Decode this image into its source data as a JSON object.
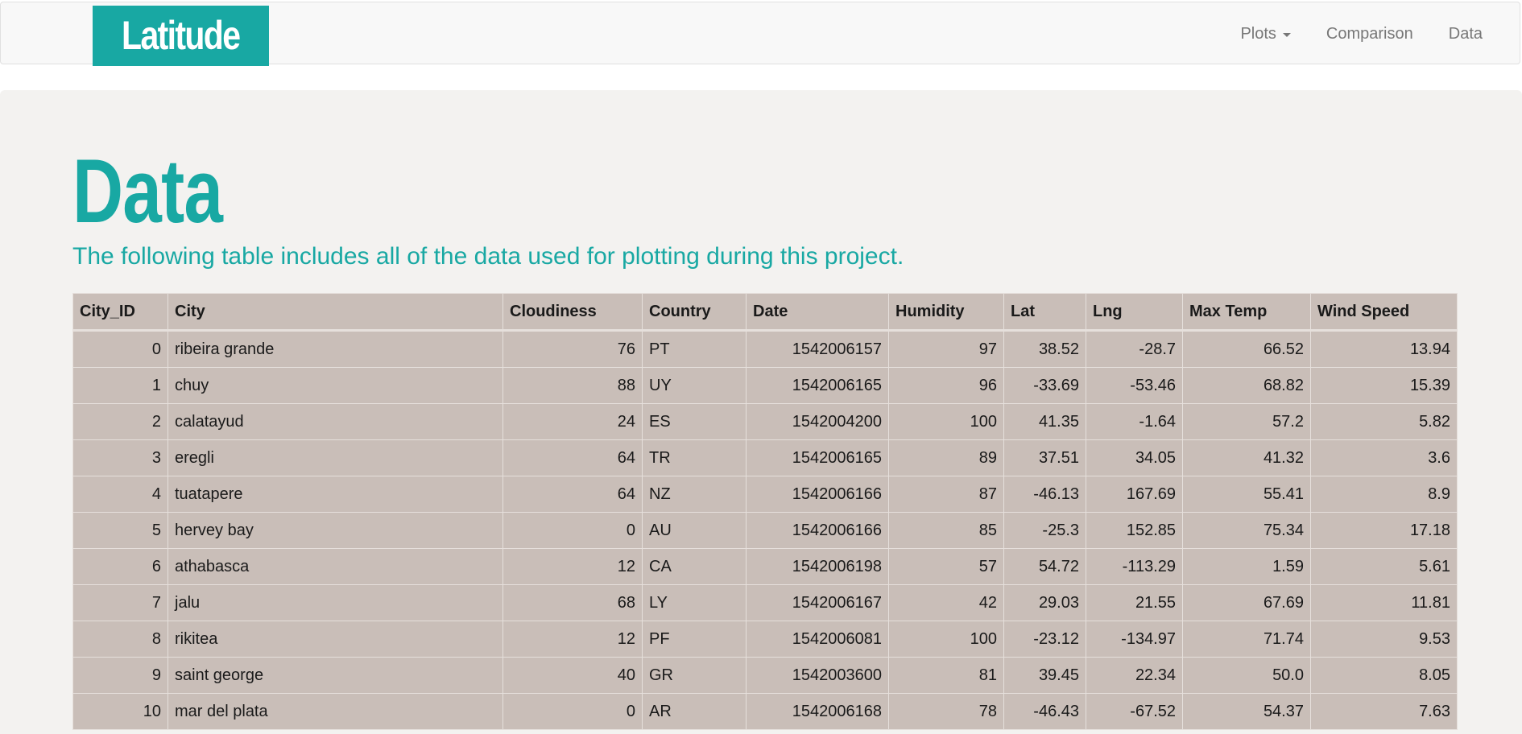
{
  "navbar": {
    "brand": "Latitude",
    "links": [
      {
        "label": "Plots",
        "has_dropdown": true
      },
      {
        "label": "Comparison",
        "has_dropdown": false
      },
      {
        "label": "Data",
        "has_dropdown": false
      }
    ]
  },
  "page": {
    "title": "Data",
    "subtitle": "The following table includes all of the data used for plotting during this project."
  },
  "colors": {
    "accent": "#18a8a3",
    "table_bg": "#c9beb8",
    "jumbotron_bg": "#f3f2f0"
  },
  "table": {
    "columns": [
      "City_ID",
      "City",
      "Cloudiness",
      "Country",
      "Date",
      "Humidity",
      "Lat",
      "Lng",
      "Max Temp",
      "Wind Speed"
    ],
    "rows": [
      [
        "0",
        "ribeira grande",
        "76",
        "PT",
        "1542006157",
        "97",
        "38.52",
        "-28.7",
        "66.52",
        "13.94"
      ],
      [
        "1",
        "chuy",
        "88",
        "UY",
        "1542006165",
        "96",
        "-33.69",
        "-53.46",
        "68.82",
        "15.39"
      ],
      [
        "2",
        "calatayud",
        "24",
        "ES",
        "1542004200",
        "100",
        "41.35",
        "-1.64",
        "57.2",
        "5.82"
      ],
      [
        "3",
        "eregli",
        "64",
        "TR",
        "1542006165",
        "89",
        "37.51",
        "34.05",
        "41.32",
        "3.6"
      ],
      [
        "4",
        "tuatapere",
        "64",
        "NZ",
        "1542006166",
        "87",
        "-46.13",
        "167.69",
        "55.41",
        "8.9"
      ],
      [
        "5",
        "hervey bay",
        "0",
        "AU",
        "1542006166",
        "85",
        "-25.3",
        "152.85",
        "75.34",
        "17.18"
      ],
      [
        "6",
        "athabasca",
        "12",
        "CA",
        "1542006198",
        "57",
        "54.72",
        "-113.29",
        "1.59",
        "5.61"
      ],
      [
        "7",
        "jalu",
        "68",
        "LY",
        "1542006167",
        "42",
        "29.03",
        "21.55",
        "67.69",
        "11.81"
      ],
      [
        "8",
        "rikitea",
        "12",
        "PF",
        "1542006081",
        "100",
        "-23.12",
        "-134.97",
        "71.74",
        "9.53"
      ],
      [
        "9",
        "saint george",
        "40",
        "GR",
        "1542003600",
        "81",
        "39.45",
        "22.34",
        "50.0",
        "8.05"
      ],
      [
        "10",
        "mar del plata",
        "0",
        "AR",
        "1542006168",
        "78",
        "-46.43",
        "-67.52",
        "54.37",
        "7.63"
      ]
    ]
  }
}
